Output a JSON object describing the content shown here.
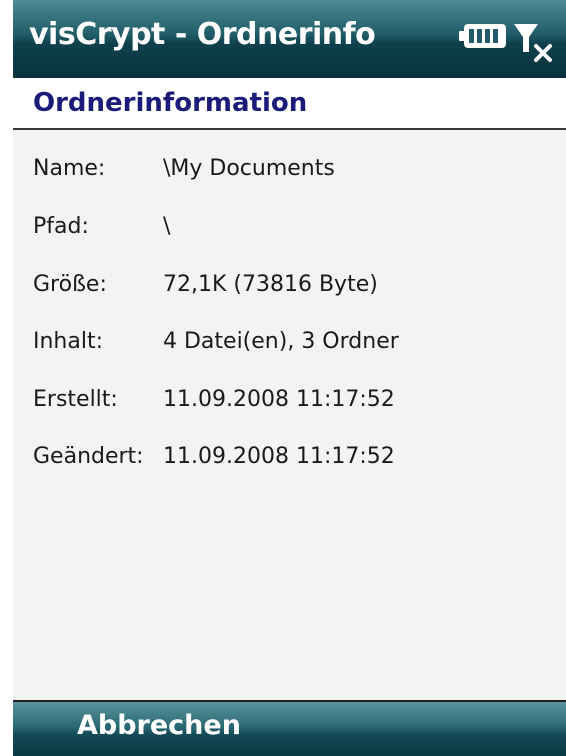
{
  "title_bar": {
    "title": "visCrypt - Ordnerinfo",
    "icons": [
      "battery-icon",
      "signal-off-icon"
    ]
  },
  "section": {
    "title": "Ordnerinformation"
  },
  "info": {
    "rows": [
      {
        "label": "Name:",
        "value": "\\My Documents"
      },
      {
        "label": "Pfad:",
        "value": "\\"
      },
      {
        "label": "Größe:",
        "value": "72,1K (73816 Byte)"
      },
      {
        "label": "Inhalt:",
        "value": "4 Datei(en), 3 Ordner"
      },
      {
        "label": "Erstellt:",
        "value": "11.09.2008 11:17:52"
      },
      {
        "label": "Geändert:",
        "value": "11.09.2008 11:17:52"
      }
    ]
  },
  "softkeys": {
    "left_label": "Abbrechen"
  },
  "colors": {
    "title_bar": "#1f5c68",
    "section_title": "#1b1b7a",
    "content_bg": "#f3f3f3"
  }
}
